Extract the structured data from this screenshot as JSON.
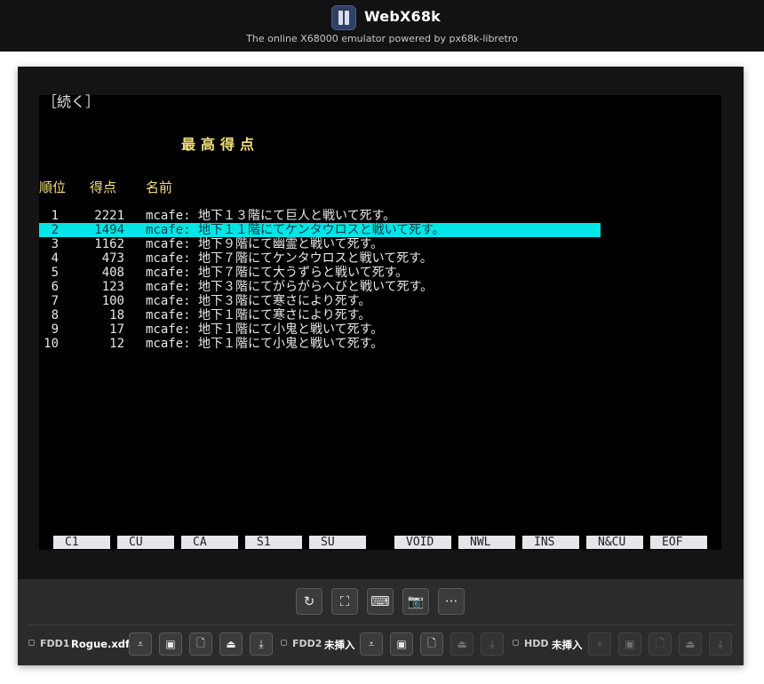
{
  "header": {
    "title": "WebX68k",
    "subtitle": "The online X68000 emulator powered by px68k-libretro",
    "logo_icon": "webx68k-logo-icon"
  },
  "screen": {
    "continue_text": "［続く］",
    "highscore_title": "最高得点",
    "columns": {
      "rank": "順位",
      "score": "得点",
      "name": "名前"
    },
    "rows": [
      {
        "rank": "1",
        "score": "2221",
        "message": "mcafe: 地下１３階にて巨人と戦いて死す。",
        "highlight": false
      },
      {
        "rank": "2",
        "score": "1494",
        "message": "mcafe: 地下１１階にてケンタウロスと戦いて死す。",
        "highlight": true
      },
      {
        "rank": "3",
        "score": "1162",
        "message": "mcafe: 地下９階にて幽霊と戦いて死す。",
        "highlight": false
      },
      {
        "rank": "4",
        "score": "473",
        "message": "mcafe: 地下７階にてケンタウロスと戦いて死す。",
        "highlight": false
      },
      {
        "rank": "5",
        "score": "408",
        "message": "mcafe: 地下７階にて大うずらと戦いて死す。",
        "highlight": false
      },
      {
        "rank": "6",
        "score": "123",
        "message": "mcafe: 地下３階にてがらがらへびと戦いて死す。",
        "highlight": false
      },
      {
        "rank": "7",
        "score": "100",
        "message": "mcafe: 地下３階にて寒さにより死す。",
        "highlight": false
      },
      {
        "rank": "8",
        "score": "18",
        "message": "mcafe: 地下１階にて寒さにより死す。",
        "highlight": false
      },
      {
        "rank": "9",
        "score": "17",
        "message": "mcafe: 地下１階にて小鬼と戦いて死す。",
        "highlight": false
      },
      {
        "rank": "10",
        "score": "12",
        "message": "mcafe: 地下１階にて小鬼と戦いて死す。",
        "highlight": false
      }
    ],
    "function_keys": [
      "C1",
      "CU",
      "CA",
      "S1",
      "SU",
      "VOID",
      "NWL",
      "INS",
      "N&CU",
      "EOF"
    ],
    "highlight_color": "#00e5e5",
    "title_color": "#f2e07a"
  },
  "toolbar": {
    "buttons": [
      {
        "icon": "reset-icon",
        "glyph": "↻"
      },
      {
        "icon": "fullscreen-icon",
        "glyph": "⛶"
      },
      {
        "icon": "keyboard-icon",
        "glyph": "⌨"
      },
      {
        "icon": "camera-icon",
        "glyph": "📷"
      },
      {
        "icon": "more-icon",
        "glyph": "···"
      }
    ]
  },
  "drives": [
    {
      "label": "FDD1",
      "name": "Rogue.xdf",
      "enabled": true
    },
    {
      "label": "FDD2",
      "name": "未挿入",
      "enabled": true
    },
    {
      "label": "HDD",
      "name": "未挿入",
      "enabled": false
    }
  ],
  "drive_button_icons": [
    {
      "icon": "select-media-icon",
      "glyph": "⩡"
    },
    {
      "icon": "disk-image-icon",
      "glyph": "▣"
    },
    {
      "icon": "new-file-icon",
      "glyph": "🗋"
    },
    {
      "icon": "eject-icon",
      "glyph": "⏏"
    },
    {
      "icon": "download-icon",
      "glyph": "⤓"
    }
  ]
}
